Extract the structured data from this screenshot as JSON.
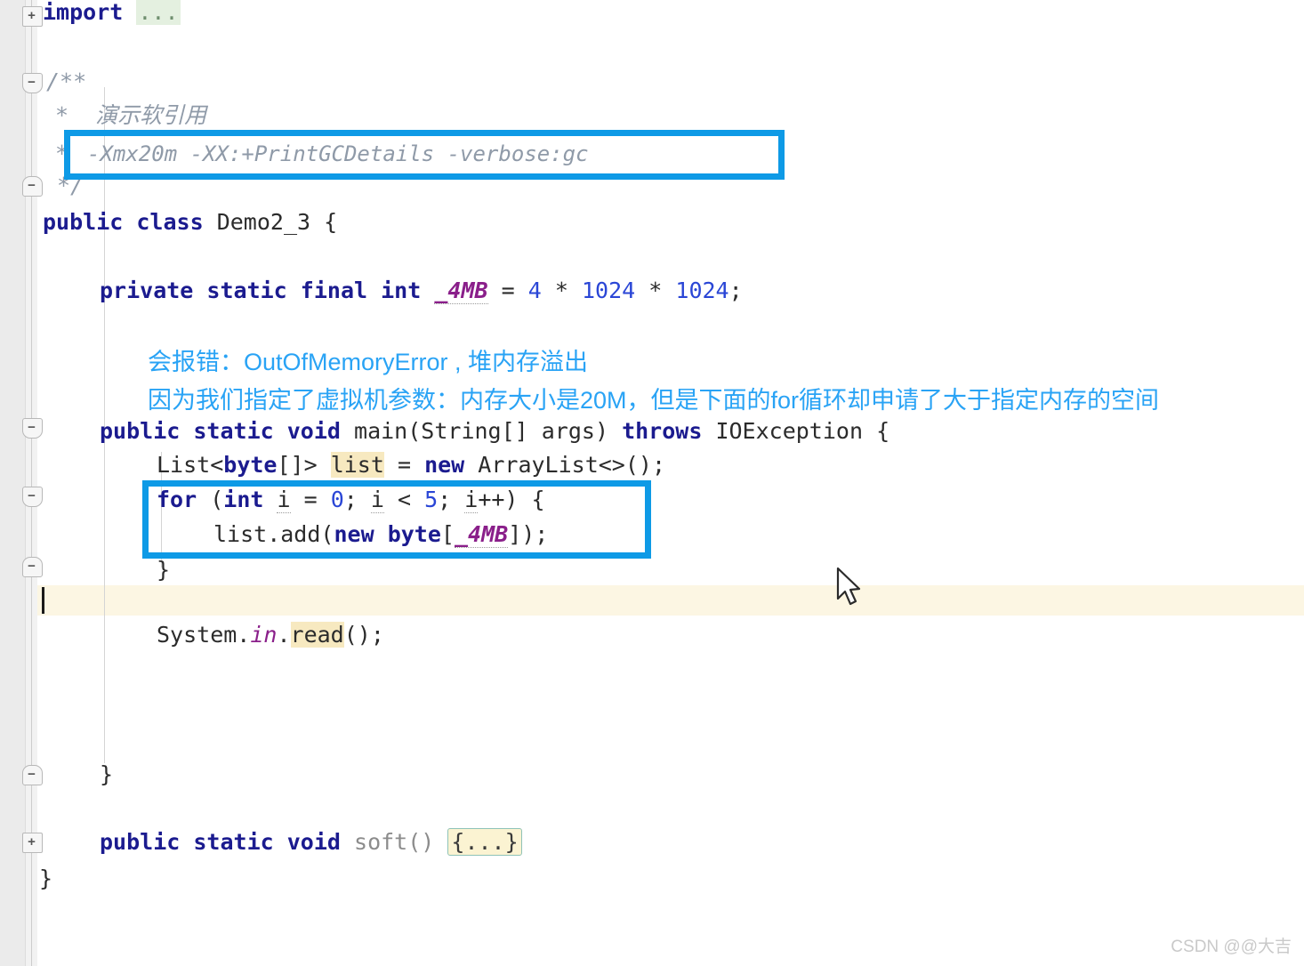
{
  "editor": {
    "language": "java",
    "file_class_name": "Demo2_3",
    "colors": {
      "keyword": "#1b1b8f",
      "number": "#2a46d6",
      "static_field": "#8a1f8a",
      "comment": "#8f9aa8",
      "annotation_blue": "#29a3f5",
      "highlight_box_blue": "#0e9ae6",
      "caret_line": "#fcf6e3",
      "identifier_highlight": "#f7e9c0",
      "folded_region": "#fbf3d2",
      "gutter": "#ebebeb"
    }
  },
  "code": {
    "import_keyword": "import",
    "import_folded": "...",
    "comment_open": "/**",
    "comment_star": "*",
    "comment_title": "演示软引用",
    "vm_options": "-Xmx20m -XX:+PrintGCDetails -verbose:gc",
    "comment_close": "*/",
    "class_kw_public": "public",
    "class_kw_class": "class",
    "class_name": "Demo2_3",
    "class_brace": "{",
    "field_private": "private",
    "field_static": "static",
    "field_final": "final",
    "field_int": "int",
    "field_name": "_4MB",
    "field_eq": "=",
    "field_v1": "4",
    "field_op1": "*",
    "field_v2": "1024",
    "field_op2": "*",
    "field_v3": "1024",
    "field_semi": ";",
    "main_public": "public",
    "main_static": "static",
    "main_void": "void",
    "main_name": "main(String[] args)",
    "main_throws": "throws",
    "main_exception": "IOException {",
    "list_decl_type": "List<",
    "list_decl_byte": "byte",
    "list_decl_type2": "[]> ",
    "list_decl_var": "list",
    "list_decl_mid": " = ",
    "list_decl_new": "new",
    "list_decl_tail": " ArrayList<>();",
    "for_kw": "for",
    "for_open": " (",
    "for_int": "int",
    "for_i1": "i",
    "for_assign": " = ",
    "for_zero": "0",
    "for_semi1": "; ",
    "for_i2": "i",
    "for_lt": " < ",
    "for_five": "5",
    "for_semi2": "; ",
    "for_i3": "i",
    "for_inc": "++) {",
    "body_add_pre": "list.add(",
    "body_add_new": "new",
    "body_add_byte": "byte",
    "body_add_brkt": "[",
    "body_add_field": "_4MB",
    "body_add_tail": "]);",
    "for_close_brace": "}",
    "sysin_a": "System.",
    "sysin_in": "in",
    "sysin_dot": ".",
    "sysin_read": "read",
    "sysin_tail": "();",
    "main_close_brace": "}",
    "soft_public": "public",
    "soft_static": "static",
    "soft_void": "void",
    "soft_name": "soft()",
    "soft_folded": "{...}",
    "class_close_brace": "}"
  },
  "annotations": {
    "line1": "会报错：OutOfMemoryError , 堆内存溢出",
    "line2": "因为我们指定了虚拟机参数：内存大小是20M，但是下面的for循环却申请了大于指定内存的空间"
  },
  "gutter": {
    "fold_import": "+",
    "fold_comment": "−",
    "fold_comment_end": "−",
    "fold_main": "−",
    "fold_for": "−",
    "fold_for_end": "−",
    "fold_main_end": "−",
    "fold_soft": "+"
  },
  "watermark": {
    "text": "CSDN @@大吉"
  }
}
